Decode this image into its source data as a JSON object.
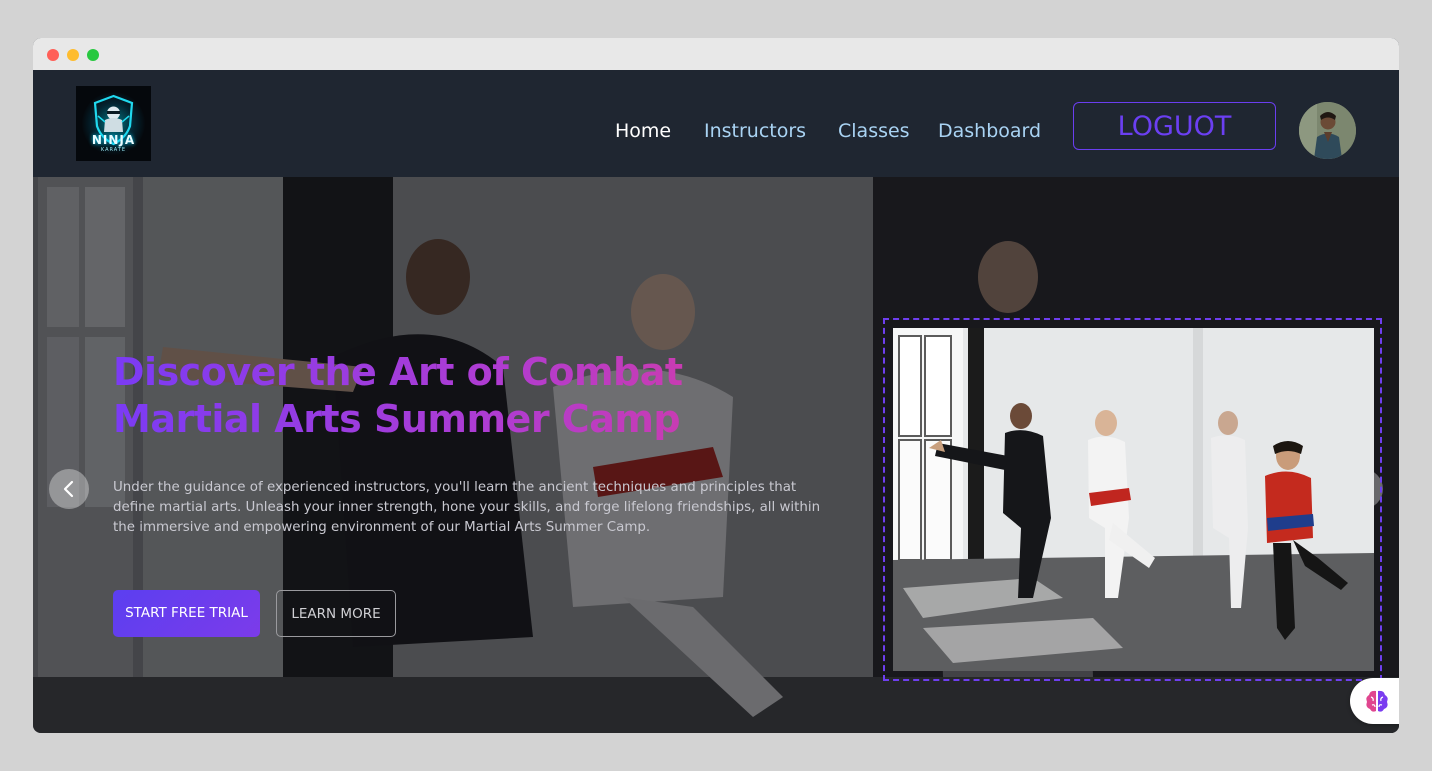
{
  "window": {
    "controls": [
      "close",
      "minimize",
      "maximize"
    ]
  },
  "navbar": {
    "logo": {
      "text": "NINJA",
      "subtext": "KARATE",
      "icon": "ninja-shield-logo"
    },
    "links": [
      {
        "label": "Home",
        "active": true
      },
      {
        "label": "Instructors",
        "active": false
      },
      {
        "label": "Classes",
        "active": false
      },
      {
        "label": "Dashboard",
        "active": false
      }
    ],
    "logout_label": "LOGUOT",
    "avatar_icon": "user-avatar"
  },
  "hero": {
    "title_line1": "Discover the Art of Combat",
    "title_line2": "Martial Arts Summer Camp",
    "description": "Under the guidance of experienced instructors, you'll learn the ancient techniques and principles that define martial arts. Unleash your inner strength, hone your skills, and forge lifelong friendships, all within the immersive and empowering environment of our Martial Arts Summer Camp.",
    "primary_button": "START FREE TRIAL",
    "secondary_button": "LEARN MORE",
    "prev_icon": "chevron-left-icon",
    "next_icon": "chevron-right-icon",
    "image_description": "martial-arts-class-photo"
  },
  "floating_widget": {
    "icon": "brain-icon"
  },
  "colors": {
    "accent": "#6b3ff2",
    "nav_bg": "#1f2631",
    "nav_link": "#a9d3f3",
    "title_gradient_start": "#7b3bf5",
    "title_gradient_end": "#d93b9c"
  }
}
